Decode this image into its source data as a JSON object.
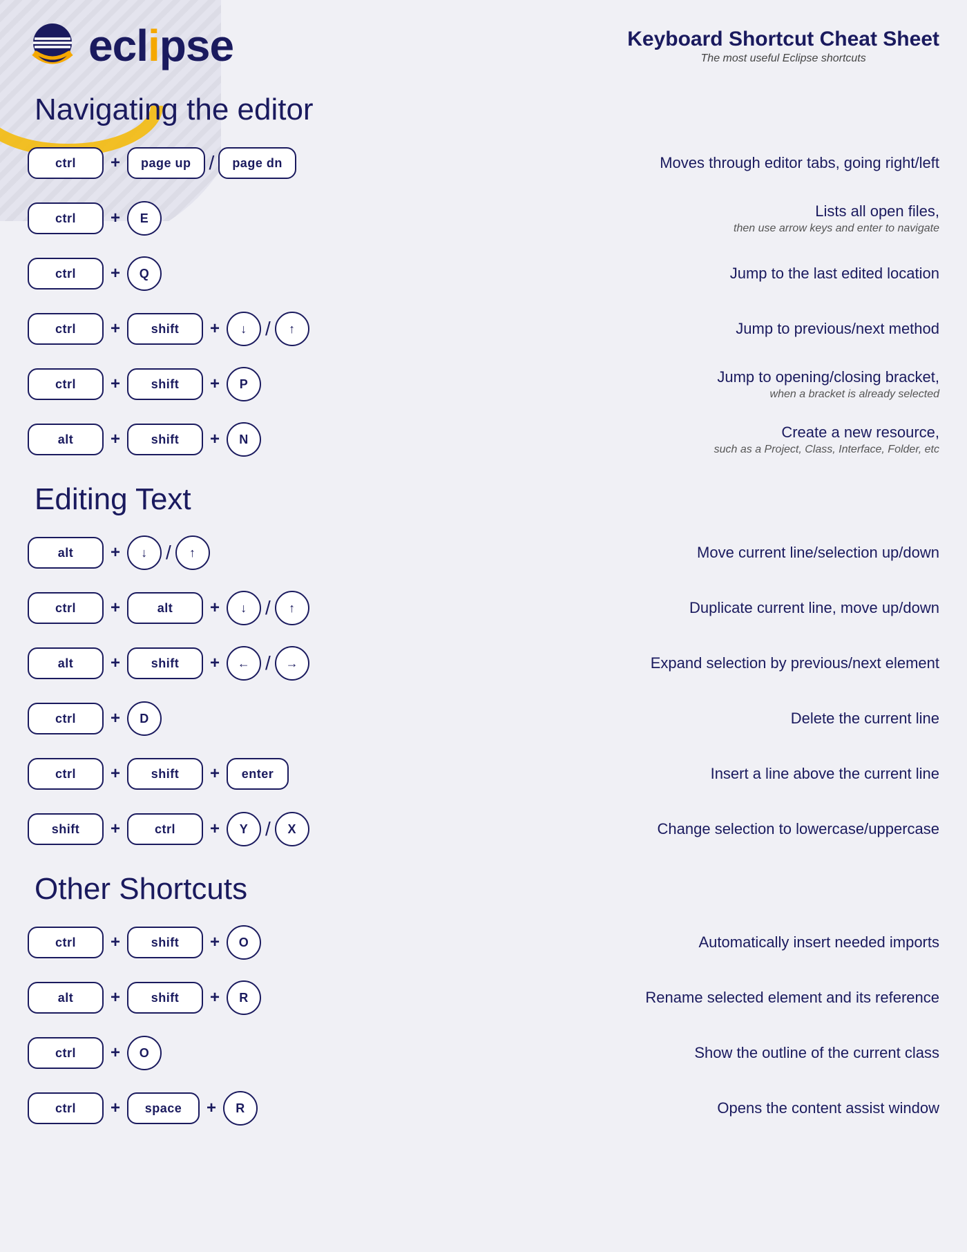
{
  "header": {
    "logo_text": "eclipse",
    "title": "Keyboard Shortcut Cheat Sheet",
    "subtitle": "The most useful Eclipse shortcuts"
  },
  "sections": [
    {
      "id": "nav",
      "title": "Navigating the editor",
      "shortcuts": [
        {
          "keys": [
            [
              "ctrl"
            ],
            "+",
            [
              "page up"
            ],
            "/",
            [
              "page dn"
            ]
          ],
          "desc": "Moves through editor tabs, going right/left",
          "desc_sub": ""
        },
        {
          "keys": [
            [
              "ctrl"
            ],
            "+",
            [
              "E"
            ]
          ],
          "desc": "Lists all open files,",
          "desc_sub": "then use arrow keys and enter to navigate"
        },
        {
          "keys": [
            [
              "ctrl"
            ],
            "+",
            [
              "Q"
            ]
          ],
          "desc": "Jump to the last edited location",
          "desc_sub": ""
        },
        {
          "keys": [
            [
              "ctrl"
            ],
            "+",
            [
              "shift"
            ],
            "+",
            [
              "↓"
            ],
            "/",
            [
              "↑"
            ]
          ],
          "desc": "Jump to previous/next method",
          "desc_sub": ""
        },
        {
          "keys": [
            [
              "ctrl"
            ],
            "+",
            [
              "shift"
            ],
            "+",
            [
              "P"
            ]
          ],
          "desc": "Jump to opening/closing bracket,",
          "desc_sub": "when a bracket is already selected"
        },
        {
          "keys": [
            [
              "alt"
            ],
            "+",
            [
              "shift"
            ],
            "+",
            [
              "N"
            ]
          ],
          "desc": "Create a new resource,",
          "desc_sub": "such as a Project, Class, Interface, Folder, etc"
        }
      ]
    },
    {
      "id": "edit",
      "title": "Editing Text",
      "shortcuts": [
        {
          "keys": [
            [
              "alt"
            ],
            "+",
            [
              "↓"
            ],
            "/",
            [
              "↑"
            ]
          ],
          "desc": "Move current line/selection up/down",
          "desc_sub": ""
        },
        {
          "keys": [
            [
              "ctrl"
            ],
            "+",
            [
              "alt"
            ],
            "+",
            [
              "↓"
            ],
            "/",
            [
              "↑"
            ]
          ],
          "desc": "Duplicate current line, move up/down",
          "desc_sub": ""
        },
        {
          "keys": [
            [
              "alt"
            ],
            "+",
            [
              "shift"
            ],
            "+",
            [
              "←"
            ],
            "/",
            [
              "→"
            ]
          ],
          "desc": "Expand selection by previous/next element",
          "desc_sub": ""
        },
        {
          "keys": [
            [
              "ctrl"
            ],
            "+",
            [
              "D"
            ]
          ],
          "desc": "Delete the current line",
          "desc_sub": ""
        },
        {
          "keys": [
            [
              "ctrl"
            ],
            "+",
            [
              "shift"
            ],
            "+",
            [
              "enter"
            ]
          ],
          "desc": "Insert a line above the current line",
          "desc_sub": ""
        },
        {
          "keys": [
            [
              "shift"
            ],
            "+",
            [
              "ctrl"
            ],
            "+",
            [
              "Y"
            ],
            "/",
            [
              "X"
            ]
          ],
          "desc": "Change selection to lowercase/uppercase",
          "desc_sub": ""
        }
      ]
    },
    {
      "id": "other",
      "title": "Other Shortcuts",
      "shortcuts": [
        {
          "keys": [
            [
              "ctrl"
            ],
            "+",
            [
              "shift"
            ],
            "+",
            [
              "O"
            ]
          ],
          "desc": "Automatically insert needed imports",
          "desc_sub": ""
        },
        {
          "keys": [
            [
              "alt"
            ],
            "+",
            [
              "shift"
            ],
            "+",
            [
              "R"
            ]
          ],
          "desc": "Rename selected element and its reference",
          "desc_sub": ""
        },
        {
          "keys": [
            [
              "ctrl"
            ],
            "+",
            [
              "O"
            ]
          ],
          "desc": "Show the outline of the current class",
          "desc_sub": ""
        },
        {
          "keys": [
            [
              "ctrl"
            ],
            "+",
            [
              "space"
            ],
            "+",
            [
              "R"
            ]
          ],
          "desc": "Opens the content assist window",
          "desc_sub": ""
        }
      ]
    }
  ]
}
